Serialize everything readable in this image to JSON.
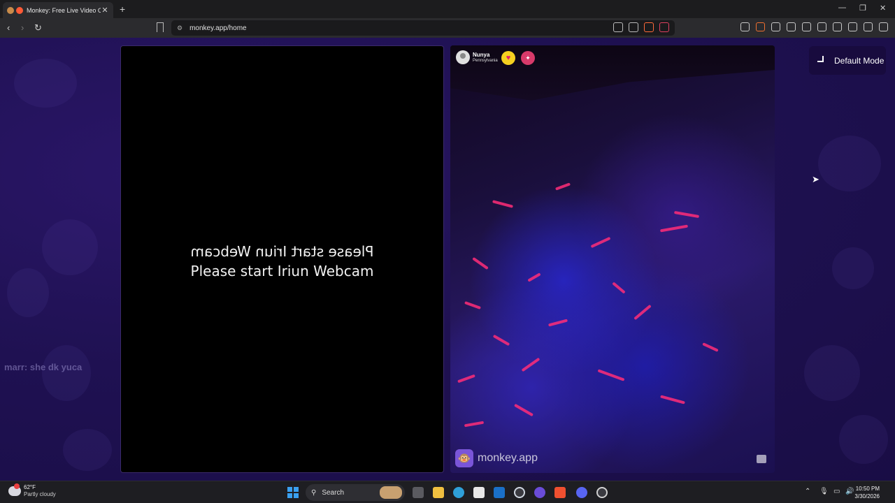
{
  "browser": {
    "tab_title": "Monkey: Free Live Video Chat",
    "tab_close": "✕",
    "new_tab": "+",
    "url": "monkey.app/home",
    "window_controls": [
      "—",
      "❐",
      "✕"
    ],
    "nav": {
      "back": "‹",
      "forward": "›",
      "reload": "↻"
    }
  },
  "page": {
    "chat_message": "marr: she dk yuca",
    "left_panel": {
      "mirrored_message": "Please start Iriun Webcam",
      "message": "Please start Iriun Webcam"
    },
    "right_panel": {
      "user_name": "Nunya",
      "user_location": "Pennsylvania",
      "brand_text": "monkey.app"
    },
    "mode_button": "Default Mode"
  },
  "taskbar": {
    "weather_temp": "62°F",
    "weather_desc": "Partly cloudy",
    "search_label": "Search",
    "time": "10:50 PM",
    "date": "3/30/2026"
  },
  "colors": {
    "page_bg": "#1f1152",
    "accent_pink": "#ff2d78",
    "heart_badge": "#f5d020",
    "gift_badge": "#d83a6a"
  }
}
